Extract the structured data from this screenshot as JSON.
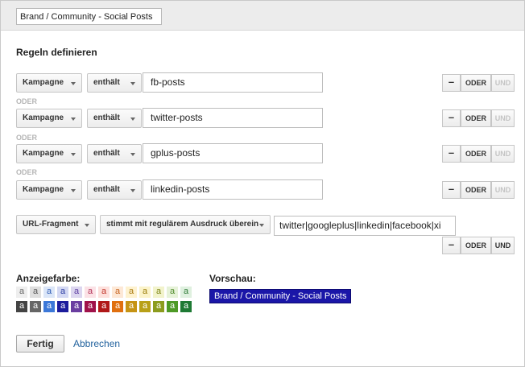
{
  "segment_name": "Brand / Community - Social Posts",
  "heading": "Regeln definieren",
  "rules": [
    {
      "dimension": "Kampagne",
      "operator": "enthält",
      "value": "fb-posts",
      "minus": "–",
      "or": "ODER",
      "and": "UND"
    },
    {
      "dimension": "Kampagne",
      "operator": "enthält",
      "value": "twitter-posts",
      "minus": "–",
      "or": "ODER",
      "and": "UND"
    },
    {
      "dimension": "Kampagne",
      "operator": "enthält",
      "value": "gplus-posts",
      "minus": "–",
      "or": "ODER",
      "and": "UND"
    },
    {
      "dimension": "Kampagne",
      "operator": "enthält",
      "value": "linkedin-posts",
      "minus": "–",
      "or": "ODER",
      "and": "UND"
    },
    {
      "dimension": "URL-Fragment",
      "operator": "stimmt mit regulärem Ausdruck überein",
      "value": "twitter|googleplus|linkedin|facebook|xi",
      "minus": "–",
      "or": "ODER",
      "and": "UND"
    }
  ],
  "or_separator": "ODER",
  "color_label": "Anzeigefarbe:",
  "swatch_letter": "a",
  "swatches_light": [
    "#eeeeee",
    "#dedede",
    "#dbe6f8",
    "#d3d8f3",
    "#dcd6ef",
    "#fbe2e6",
    "#fde0dc",
    "#fde8d6",
    "#fef2cf",
    "#fbf3c9",
    "#f2f3cc",
    "#e6f2d8",
    "#dff0df"
  ],
  "swatches_light_text": [
    "#666666",
    "#555555",
    "#2d5bb4",
    "#2a3aa0",
    "#5a3aa0",
    "#b3345a",
    "#c0352a",
    "#c5621e",
    "#a87a10",
    "#9a7c08",
    "#7c8414",
    "#4f8a2a",
    "#2d7a36"
  ],
  "swatches_dark": [
    "#444444",
    "#666666",
    "#3c78d8",
    "#1c1c9c",
    "#6a3ea0",
    "#a0124a",
    "#b01818",
    "#e07010",
    "#c69414",
    "#b8a018",
    "#8c9c1e",
    "#4e9a26",
    "#1e7a34"
  ],
  "preview_label": "Vorschau:",
  "preview_text": "Brand / Community - Social Posts",
  "preview_color": "#1a16a8",
  "done_label": "Fertig",
  "cancel_label": "Abbrechen"
}
